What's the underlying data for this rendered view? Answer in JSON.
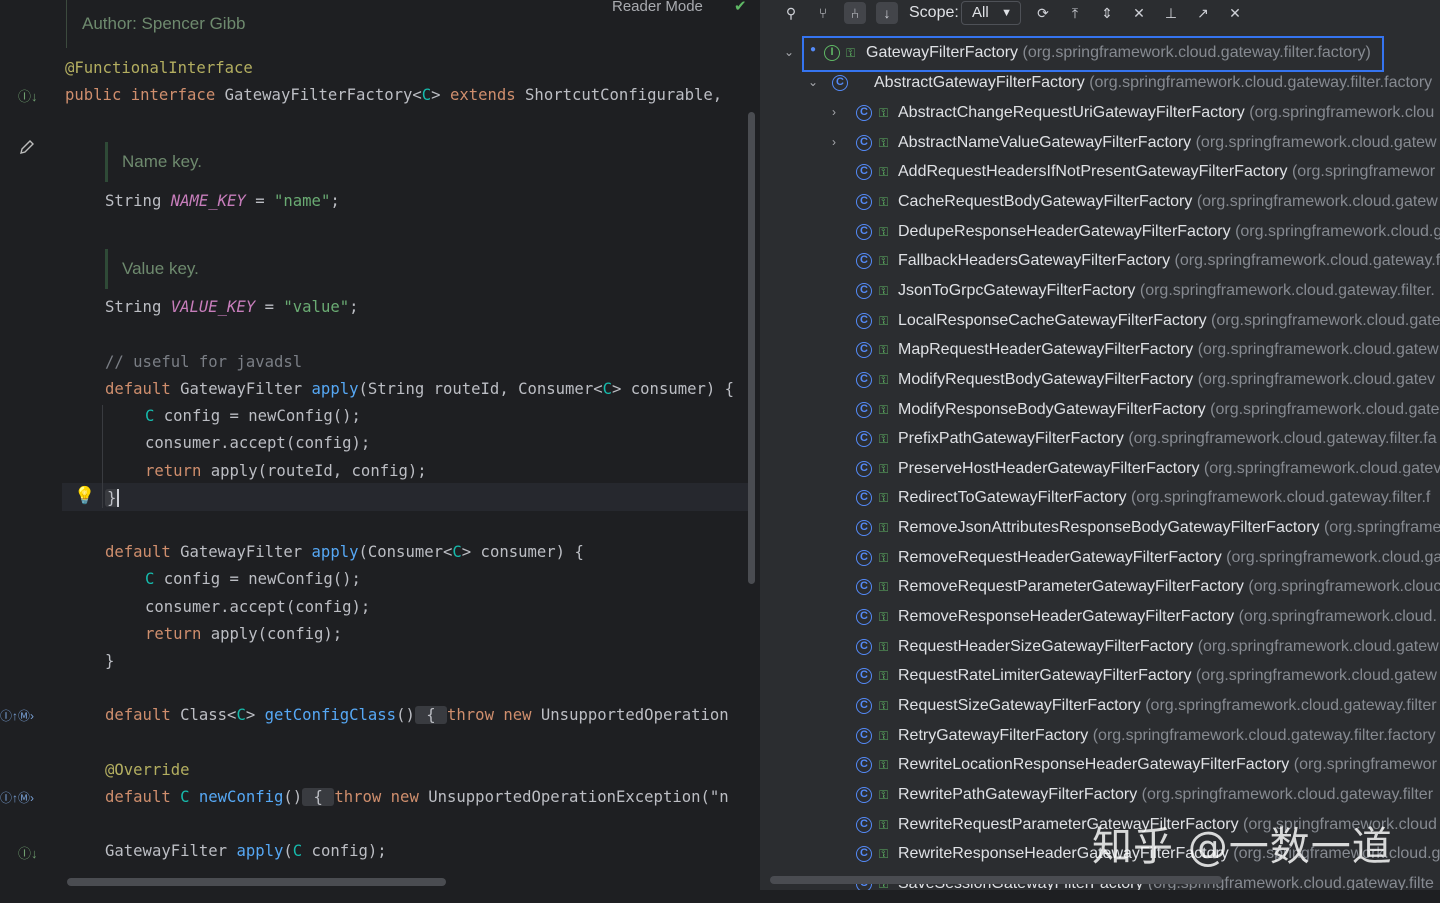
{
  "editor": {
    "reader_mode": "Reader Mode",
    "doc_author": "Author: Spencer Gibb",
    "doc_name_key": "Name key.",
    "doc_value_key": "Value key.",
    "lines": {
      "l1_ann": "@FunctionalInterface",
      "l2_a": "public interface ",
      "l2_b": "GatewayFilterFactory<",
      "l2_c": "C",
      "l2_d": "> ",
      "l2_e": "extends",
      "l2_f": " ShortcutConfigurable,",
      "l3_a": "String ",
      "l3_b": "NAME_KEY",
      "l3_c": " = ",
      "l3_d": "\"name\"",
      "l3_e": ";",
      "l4_a": "String ",
      "l4_b": "VALUE_KEY",
      "l4_c": " = ",
      "l4_d": "\"value\"",
      "l4_e": ";",
      "l5": "// useful for javadsl",
      "l6_a": "default ",
      "l6_b": "GatewayFilter ",
      "l6_c": "apply",
      "l6_d": "(String routeId, Consumer<",
      "l6_e": "C",
      "l6_f": "> consumer) {",
      "l7_a": "C",
      "l7_b": " config = newConfig();",
      "l8": "consumer.accept(config);",
      "l9_a": "return ",
      "l9_b": "apply(routeId, config);",
      "l10": "}",
      "l11_a": "default ",
      "l11_b": "GatewayFilter ",
      "l11_c": "apply",
      "l11_d": "(Consumer<",
      "l11_e": "C",
      "l11_f": "> consumer) {",
      "l12_a": "C",
      "l12_b": " config = newConfig();",
      "l13": "consumer.accept(config);",
      "l14_a": "return ",
      "l14_b": "apply(config);",
      "l15": "}",
      "l16_a": "default ",
      "l16_b": "Class<",
      "l16_c": "C",
      "l16_d": "> ",
      "l16_e": "getConfigClass",
      "l16_f": "()",
      "l16_g": " { ",
      "l16_h": "throw new ",
      "l16_i": "UnsupportedOperation",
      "l17": "@Override",
      "l18_a": "default ",
      "l18_b": "C ",
      "l18_c": "newConfig",
      "l18_d": "()",
      "l18_e": " { ",
      "l18_f": "throw new ",
      "l18_g": "UnsupportedOperationException(\"n",
      "l19_a": "GatewayFilter ",
      "l19_b": "apply",
      "l19_c": "(",
      "l19_d": "C",
      "l19_e": " config);"
    }
  },
  "hierarchy": {
    "scope_label": "Scope:",
    "scope_value": "All",
    "toolbar_icons": [
      "class-hierarchy-icon",
      "supertypes-icon",
      "subtypes-icon",
      "sort-alpha-icon",
      "refresh-icon",
      "scroll-to-source-icon",
      "expand-all-icon",
      "collapse-all-icon",
      "pin-icon",
      "open-in-editor-icon",
      "close-icon"
    ],
    "root": {
      "name": "GatewayFilterFactory",
      "pkg": "(org.springframework.cloud.gateway.filter.factory)"
    },
    "abstract": {
      "name": "AbstractGatewayFilterFactory",
      "pkg": "(org.springframework.cloud.gateway.filter.factory"
    },
    "items": [
      {
        "name": "AbstractChangeRequestUriGatewayFilterFactory",
        "pkg": "(org.springframework.clou",
        "expandable": true
      },
      {
        "name": "AbstractNameValueGatewayFilterFactory",
        "pkg": "(org.springframework.cloud.gatew",
        "expandable": true
      },
      {
        "name": "AddRequestHeadersIfNotPresentGatewayFilterFactory",
        "pkg": "(org.springframewor",
        "expandable": false
      },
      {
        "name": "CacheRequestBodyGatewayFilterFactory",
        "pkg": "(org.springframework.cloud.gatew",
        "expandable": false
      },
      {
        "name": "DedupeResponseHeaderGatewayFilterFactory",
        "pkg": "(org.springframework.cloud.g",
        "expandable": false
      },
      {
        "name": "FallbackHeadersGatewayFilterFactory",
        "pkg": "(org.springframework.cloud.gateway.f",
        "expandable": false
      },
      {
        "name": "JsonToGrpcGatewayFilterFactory",
        "pkg": "(org.springframework.cloud.gateway.filter.",
        "expandable": false
      },
      {
        "name": "LocalResponseCacheGatewayFilterFactory",
        "pkg": "(org.springframework.cloud.gatev",
        "expandable": false
      },
      {
        "name": "MapRequestHeaderGatewayFilterFactory",
        "pkg": "(org.springframework.cloud.gatew",
        "expandable": false
      },
      {
        "name": "ModifyRequestBodyGatewayFilterFactory",
        "pkg": "(org.springframework.cloud.gatev",
        "expandable": false
      },
      {
        "name": "ModifyResponseBodyGatewayFilterFactory",
        "pkg": "(org.springframework.cloud.gate",
        "expandable": false
      },
      {
        "name": "PrefixPathGatewayFilterFactory",
        "pkg": "(org.springframework.cloud.gateway.filter.fa",
        "expandable": false
      },
      {
        "name": "PreserveHostHeaderGatewayFilterFactory",
        "pkg": "(org.springframework.cloud.gatev",
        "expandable": false
      },
      {
        "name": "RedirectToGatewayFilterFactory",
        "pkg": "(org.springframework.cloud.gateway.filter.f",
        "expandable": false
      },
      {
        "name": "RemoveJsonAttributesResponseBodyGatewayFilterFactory",
        "pkg": "(org.springframe",
        "expandable": false
      },
      {
        "name": "RemoveRequestHeaderGatewayFilterFactory",
        "pkg": "(org.springframework.cloud.ga",
        "expandable": false
      },
      {
        "name": "RemoveRequestParameterGatewayFilterFactory",
        "pkg": "(org.springframework.clouc",
        "expandable": false
      },
      {
        "name": "RemoveResponseHeaderGatewayFilterFactory",
        "pkg": "(org.springframework.cloud.",
        "expandable": false
      },
      {
        "name": "RequestHeaderSizeGatewayFilterFactory",
        "pkg": "(org.springframework.cloud.gatew",
        "expandable": false
      },
      {
        "name": "RequestRateLimiterGatewayFilterFactory",
        "pkg": "(org.springframework.cloud.gatew",
        "expandable": false
      },
      {
        "name": "RequestSizeGatewayFilterFactory",
        "pkg": "(org.springframework.cloud.gateway.filter",
        "expandable": false
      },
      {
        "name": "RetryGatewayFilterFactory",
        "pkg": "(org.springframework.cloud.gateway.filter.factory",
        "expandable": false
      },
      {
        "name": "RewriteLocationResponseHeaderGatewayFilterFactory",
        "pkg": "(org.springframewor",
        "expandable": false
      },
      {
        "name": "RewritePathGatewayFilterFactory",
        "pkg": "(org.springframework.cloud.gateway.filter",
        "expandable": false
      },
      {
        "name": "RewriteRequestParameterGatewayFilterFactory",
        "pkg": "(org.springframework.cloud",
        "expandable": false
      },
      {
        "name": "RewriteResponseHeaderGatewayFilterFactory",
        "pkg": "(org.springframework.cloud.g",
        "expandable": false
      },
      {
        "name": "SaveSessionGatewayFilterFactory",
        "pkg": "(org.springframework.cloud.gateway.filte",
        "expandable": false
      }
    ]
  },
  "watermark": "知乎 @一数一道"
}
